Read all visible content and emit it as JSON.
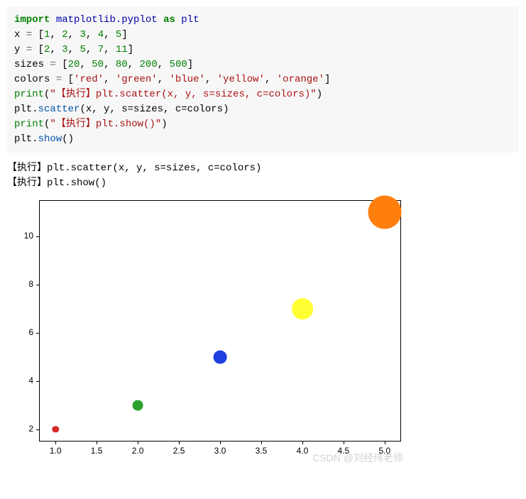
{
  "code": {
    "l1_import": "import",
    "l1_mod1": "matplotlib.pyplot",
    "l1_as": "as",
    "l1_mod2": "plt",
    "l2_lhs": "x",
    "l2_eq": "=",
    "l2_list": "[1, 2, 3, 4, 5]",
    "l3_lhs": "y",
    "l3_eq": "=",
    "l3_list": "[2, 3, 5, 7, 11]",
    "l4_lhs": "sizes",
    "l4_eq": "=",
    "l4_list": "[20, 50, 80, 200, 500]",
    "l5_lhs": "colors",
    "l5_eq": "=",
    "l5_list": "['red', 'green', 'blue', 'yellow', 'orange']",
    "l6_print": "print",
    "l6_arg": "\"【执行】plt.scatter(x, y, s=sizes, c=colors)\"",
    "l7_obj": "plt",
    "l7_meth": "scatter",
    "l7_args": "(x, y, s=sizes, c=colors)",
    "l8_print": "print",
    "l8_arg": "\"【执行】plt.show()\"",
    "l9_obj": "plt",
    "l9_meth": "show",
    "l9_args": "()"
  },
  "output": {
    "line1": "【执行】plt.scatter(x, y, s=sizes, c=colors)",
    "line2": "【执行】plt.show()"
  },
  "watermark": "CSDN @刘经纬老师",
  "chart_data": {
    "type": "scatter",
    "x": [
      1,
      2,
      3,
      4,
      5
    ],
    "y": [
      2,
      3,
      5,
      7,
      11
    ],
    "sizes": [
      20,
      50,
      80,
      200,
      500
    ],
    "colors": [
      "red",
      "green",
      "blue",
      "yellow",
      "orange"
    ],
    "xlim": [
      0.8,
      5.2
    ],
    "ylim": [
      1.5,
      11.5
    ],
    "xticks": [
      1.0,
      1.5,
      2.0,
      2.5,
      3.0,
      3.5,
      4.0,
      4.5,
      5.0
    ],
    "yticks": [
      2,
      4,
      6,
      8,
      10
    ],
    "title": "",
    "xlabel": "",
    "ylabel": ""
  }
}
